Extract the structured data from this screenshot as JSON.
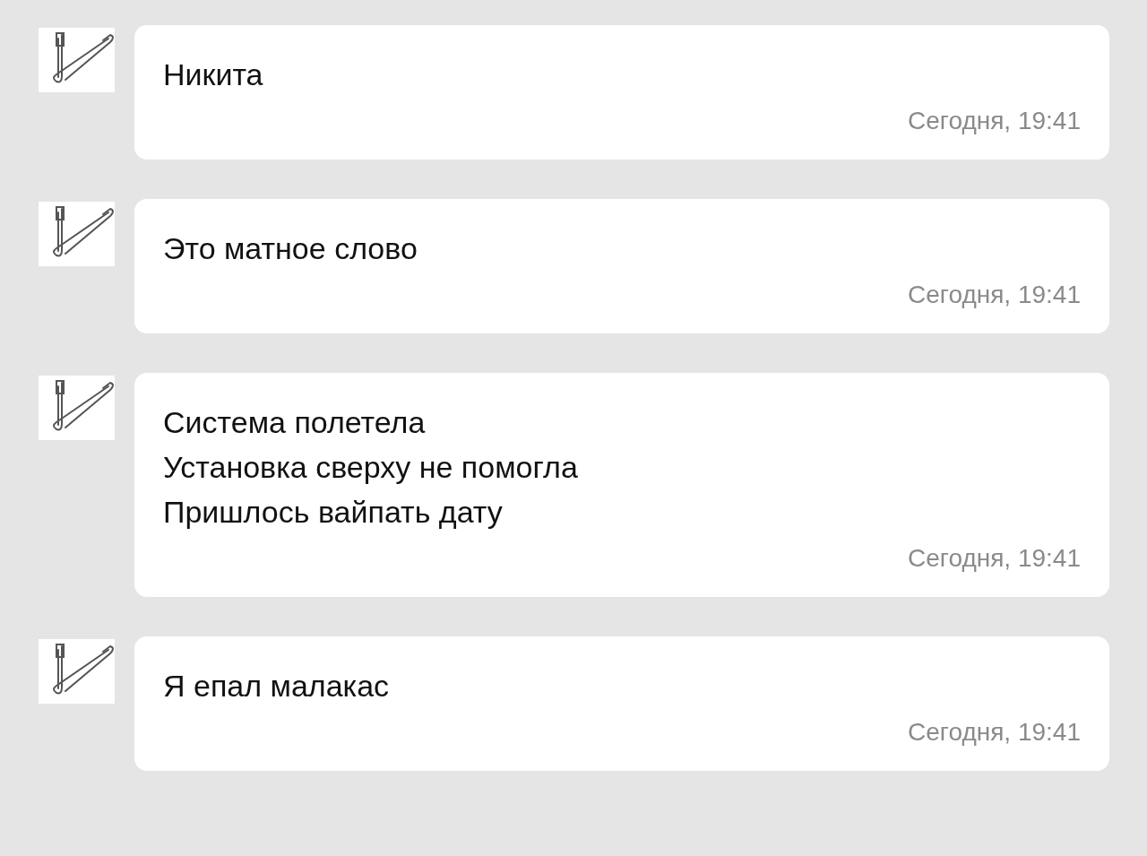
{
  "messages": [
    {
      "lines": [
        "Никита"
      ],
      "time": "Сегодня, 19:41"
    },
    {
      "lines": [
        "Это матное слово"
      ],
      "time": "Сегодня, 19:41"
    },
    {
      "lines": [
        "Система полетела",
        "Установка сверху не помогла",
        "Пришлось вайпать дату"
      ],
      "time": "Сегодня, 19:41"
    },
    {
      "lines": [
        "Я епал малакас"
      ],
      "time": "Сегодня, 19:41"
    }
  ]
}
